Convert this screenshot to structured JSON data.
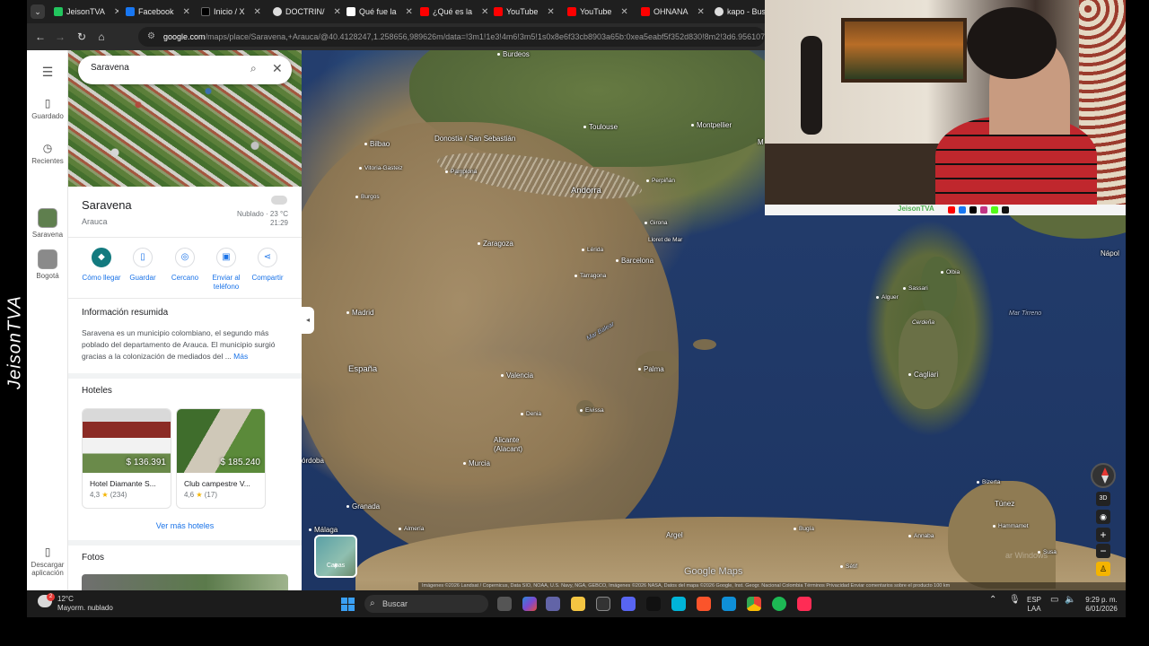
{
  "overlay": {
    "brand": "JeisonTVA"
  },
  "browser": {
    "tabs": [
      {
        "label": "JeisonTVA",
        "color": "#22c55e"
      },
      {
        "label": "Facebook",
        "color": "#1877f2"
      },
      {
        "label": "Inicio / X",
        "color": "#000000"
      },
      {
        "label": "DOCTRIN/",
        "color": "#dddddd"
      },
      {
        "label": "Qué fue la",
        "color": "#ffffff"
      },
      {
        "label": "¿Qué es la",
        "color": "#ff0000"
      },
      {
        "label": "YouTube",
        "color": "#ff0000"
      },
      {
        "label": "YouTube",
        "color": "#ff0000"
      },
      {
        "label": "OHNANA",
        "color": "#ff0000"
      },
      {
        "label": "kapo - Bus",
        "color": "#dddddd"
      }
    ],
    "url_host": "google.com",
    "url_rest": "/maps/place/Saravena,+Arauca/@40.4128247,1.258656,989626m/data=!3m1!1e3!4m6!3m5!1s0x8e6f33cb8903a65b:0xea5eabf5f352d830!8m2!3d6.9561074!4d-71.8725"
  },
  "rail": {
    "items": [
      {
        "label": "Guardado"
      },
      {
        "label": "Recientes"
      },
      {
        "label": "Saravena"
      },
      {
        "label": "Bogotá"
      },
      {
        "label": "Descargar aplicación"
      }
    ]
  },
  "panel": {
    "search_value": "Saravena",
    "title": "Saravena",
    "subtitle": "Arauca",
    "weather": "Nublado · 23 °C",
    "time": "21:29",
    "actions": [
      {
        "label": "Cómo llegar"
      },
      {
        "label": "Guardar"
      },
      {
        "label": "Cercano"
      },
      {
        "label": "Enviar al teléfono"
      },
      {
        "label": "Compartir"
      }
    ],
    "summary_title": "Información resumida",
    "summary_text": "Saravena es un municipio colombiano, el segundo más poblado del departamento de Arauca. El municipio surgió gracias a la colonización de mediados del ...",
    "summary_more": "Más",
    "hotels_title": "Hoteles",
    "hotels": [
      {
        "price": "$ 136.391",
        "name": "Hotel Diamante S...",
        "rating": "4,3",
        "reviews": "(234)"
      },
      {
        "price": "$ 185.240",
        "name": "Club campestre V...",
        "rating": "4,6",
        "reviews": "(17)"
      }
    ],
    "see_more": "Ver más hoteles",
    "photos_title": "Fotos"
  },
  "map": {
    "labels": {
      "burdeos": "Burdeos",
      "toulouse": "Toulouse",
      "montpellier": "Montpellier",
      "marsella": "M",
      "bilbao": "Bilbao",
      "donostia": "Donostia / San Sebastián",
      "vitoria": "Vitoria-Gasteiz",
      "pamplona": "Pamplona",
      "burgos": "Burgos",
      "andorra": "Andorra",
      "perpinan": "Perpiñán",
      "girona": "Girona",
      "lloret": "Lloret de Mar",
      "zaragoza": "Zaragoza",
      "lleida": "Lérida",
      "barcelona": "Barcelona",
      "tarragona": "Tarragona",
      "madrid": "Madrid",
      "espana": "España",
      "valencia": "Valencia",
      "palma": "Palma",
      "ibiza": "Eivissa",
      "denia": "Denia",
      "alicante": "Alicante (Alacant)",
      "murcia": "Murcia",
      "cordoba": "órdoba",
      "granada": "Granada",
      "malaga": "Málaga",
      "almeria": "Almería",
      "argel": "Argel",
      "tunez": "Túnez",
      "hammamet": "Hammamet",
      "sassari": "Sassari",
      "olbia": "Olbia",
      "alguer": "Alguer",
      "cerdena": "Cerdeña",
      "cagliari": "Cagliari",
      "napoles": "Nápol",
      "mar_balear": "Mar Balear",
      "mar_tirreno": "Mar Tirreno",
      "bejaia": "Bugía",
      "setif": "Sétif",
      "annaba": "Annaba",
      "bizerta": "Bizerta",
      "soussa": "Susa"
    },
    "layers_label": "Capas",
    "brand": "Google Maps",
    "watermark": "ar Windows",
    "attribution": "Imágenes ©2026 Landsat / Copernicus, Data SIO, NOAA, U.S. Navy, NGA, GEBCO, Imágenes ©2026 NASA, Datos del mapa ©2026 Google, Inst. Geogr. Nacional   Colombia   Términos   Privacidad   Enviar comentarios sobre el producto   100 km",
    "view_3d": "3D"
  },
  "taskbar": {
    "temp": "12°C",
    "condition": "Mayorm. nublado",
    "notif_count": "2",
    "search_placeholder": "Buscar",
    "lang_top": "ESP",
    "lang_bottom": "LAA",
    "time": "9:29 p. m.",
    "date": "6/01/2026"
  },
  "colors": {
    "accent_blue": "#1a73e8",
    "teal_action": "#137a7f",
    "star": "#f4b400"
  }
}
